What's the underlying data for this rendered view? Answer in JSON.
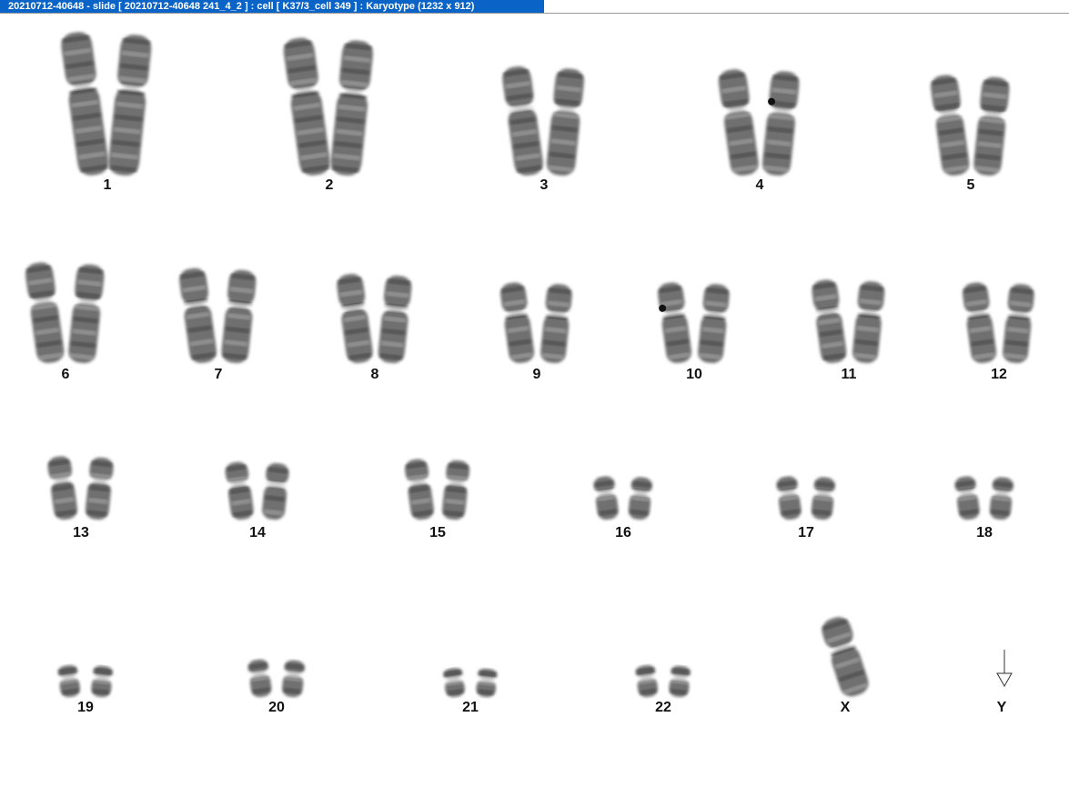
{
  "window": {
    "title": "20210712-40648 - slide [ 20210712-40648 241_4_2 ] : cell [ K37/3_cell 349 ] : Karyotype  (1232 x 912)"
  },
  "colors": {
    "titlebar_bg": "#0a64c8",
    "titlebar_text": "#ffffff",
    "chromosome_fill": "#6f6f6f",
    "band_dark": "#3e3e3e",
    "band_light": "#b0b0b0"
  },
  "karyotype": {
    "chromosomes": [
      {
        "label": "1",
        "copies": 2,
        "size": 1.0
      },
      {
        "label": "2",
        "copies": 2,
        "size": 0.96
      },
      {
        "label": "3",
        "copies": 2,
        "size": 0.76
      },
      {
        "label": "4",
        "copies": 2,
        "size": 0.74,
        "marker_on_copy": 2
      },
      {
        "label": "5",
        "copies": 2,
        "size": 0.7
      },
      {
        "label": "6",
        "copies": 2,
        "size": 0.7
      },
      {
        "label": "7",
        "copies": 2,
        "size": 0.66
      },
      {
        "label": "8",
        "copies": 2,
        "size": 0.62
      },
      {
        "label": "9",
        "copies": 2,
        "size": 0.56
      },
      {
        "label": "10",
        "copies": 2,
        "size": 0.56,
        "marker_on_copy": 1
      },
      {
        "label": "11",
        "copies": 2,
        "size": 0.58
      },
      {
        "label": "12",
        "copies": 2,
        "size": 0.56
      },
      {
        "label": "13",
        "copies": 2,
        "size": 0.44
      },
      {
        "label": "14",
        "copies": 2,
        "size": 0.4
      },
      {
        "label": "15",
        "copies": 2,
        "size": 0.42
      },
      {
        "label": "16",
        "copies": 2,
        "size": 0.3
      },
      {
        "label": "17",
        "copies": 2,
        "size": 0.3
      },
      {
        "label": "18",
        "copies": 2,
        "size": 0.3
      },
      {
        "label": "19",
        "copies": 2,
        "size": 0.22
      },
      {
        "label": "20",
        "copies": 2,
        "size": 0.26
      },
      {
        "label": "21",
        "copies": 2,
        "size": 0.2
      },
      {
        "label": "22",
        "copies": 2,
        "size": 0.22
      },
      {
        "label": "X",
        "copies": 1,
        "size": 0.56
      },
      {
        "label": "Y",
        "copies": 0,
        "size": 0,
        "missing_marker": "down-arrow-icon"
      }
    ]
  }
}
